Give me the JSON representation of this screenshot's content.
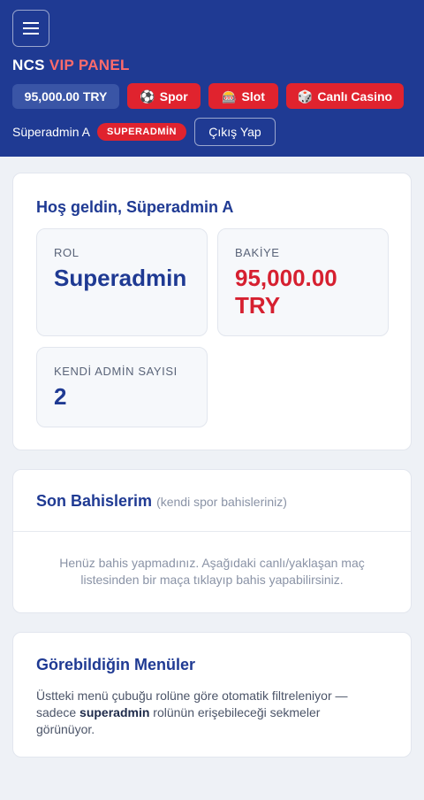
{
  "header": {
    "brand_prefix": "NCS",
    "brand_highlight": "VIP PANEL",
    "balance": "95,000.00 TRY",
    "nav": [
      {
        "label": "Spor",
        "icon": "soccer-ball-icon",
        "glyph": "⚽"
      },
      {
        "label": "Slot",
        "icon": "slot-machine-icon",
        "glyph": "🎰"
      },
      {
        "label": "Canlı Casino",
        "icon": "dice-icon",
        "glyph": "🎲"
      }
    ],
    "user_name": "Süperadmin A",
    "role_badge": "SUPERADMİN",
    "logout_label": "Çıkış Yap",
    "menu_icon": "hamburger-menu-icon"
  },
  "welcome": {
    "title": "Hoş geldin, Süperadmin A",
    "role_label": "ROL",
    "role_value": "Superadmin",
    "balance_label": "BAKİYE",
    "balance_value_line1": "95,000.00",
    "balance_value_line2": "TRY",
    "admins_label": "KENDİ ADMİN SAYISI",
    "admins_value": "2"
  },
  "bets": {
    "title": "Son Bahislerim",
    "subtitle": "(kendi spor bahisleriniz)",
    "empty_line1": "Henüz bahis yapmadınız. Aşağıdaki canlı/yaklaşan maç",
    "empty_line2": "listesinden bir maça tıklayıp bahis yapabilirsiniz."
  },
  "menus": {
    "title": "Görebildiğin Menüler",
    "text_line1": "Üstteki menü çubuğu rolüne göre otomatik filtreleniyor —",
    "text_before_bold": "sadece ",
    "text_bold": "superadmin",
    "text_after_bold": " rolünün erişebileceği sekmeler",
    "text_line3": "görünüyor."
  },
  "colors": {
    "header_bg": "#1f3a93",
    "accent_red": "#e0232e",
    "brand_highlight": "#ff6b6b",
    "page_bg": "#eef1f6"
  }
}
